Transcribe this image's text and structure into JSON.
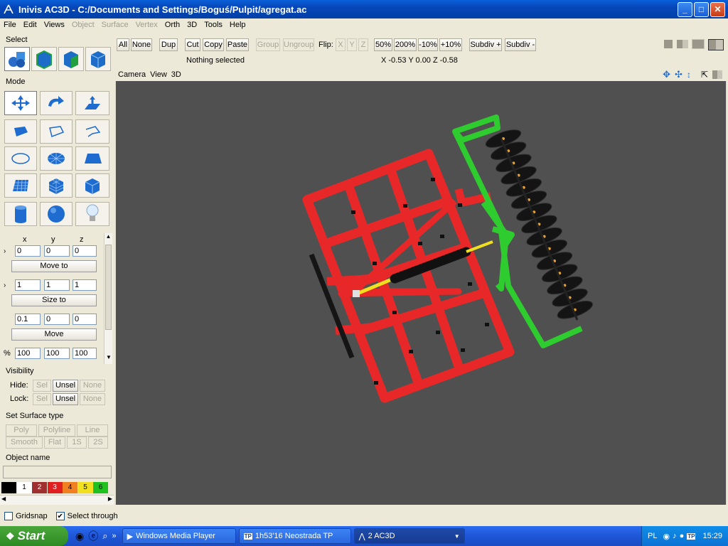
{
  "title": "Inivis AC3D - C:/Documents and Settings/Boguś/Pulpit/agregat.ac",
  "menu": [
    "File",
    "Edit",
    "Views",
    "Object",
    "Surface",
    "Vertex",
    "Orth",
    "3D",
    "Tools",
    "Help"
  ],
  "left": {
    "select_label": "Select",
    "mode_label": "Mode",
    "xyz": [
      "x",
      "y",
      "z"
    ],
    "pos": [
      "0",
      "0",
      "0"
    ],
    "move_to": "Move to",
    "size": [
      "1",
      "1",
      "1"
    ],
    "size_to": "Size to",
    "move_vals": [
      "0.1",
      "0",
      "0"
    ],
    "move": "Move",
    "pct_label": "%",
    "pct": [
      "100",
      "100",
      "100"
    ],
    "visibility_label": "Visibility",
    "hide_label": "Hide:",
    "lock_label": "Lock:",
    "sel": "Sel",
    "unsel": "Unsel",
    "none": "None",
    "surface_label": "Set Surface type",
    "poly": "Poly",
    "polyline": "Polyline",
    "line": "Line",
    "smooth": "Smooth",
    "flat": "Flat",
    "s1": "1S",
    "s2": "2S",
    "objname_label": "Object name",
    "colors": [
      {
        "n": "",
        "c": "#000000"
      },
      {
        "n": "1",
        "c": "#ffffff"
      },
      {
        "n": "2",
        "c": "#a03030"
      },
      {
        "n": "3",
        "c": "#e02020"
      },
      {
        "n": "4",
        "c": "#f08020"
      },
      {
        "n": "5",
        "c": "#f0e020"
      },
      {
        "n": "6",
        "c": "#20c020"
      }
    ]
  },
  "toolbar": {
    "all": "All",
    "none": "None",
    "dup": "Dup",
    "cut": "Cut",
    "copy": "Copy",
    "paste": "Paste",
    "group": "Group",
    "ungroup": "Ungroup",
    "flip": "Flip:",
    "fx": "X",
    "fy": "Y",
    "fz": "Z",
    "z50": "50%",
    "z200": "200%",
    "zm10": "-10%",
    "zp10": "+10%",
    "subdiv_plus": "Subdiv +",
    "subdiv_minus": "Subdiv -",
    "status": "Nothing selected",
    "coords": "X -0.53 Y 0.00 Z -0.58"
  },
  "viewport": {
    "menu": [
      "Camera",
      "View",
      "3D"
    ]
  },
  "statusbar": {
    "gridsnap": "Gridsnap",
    "select_through": "Select through"
  },
  "taskbar": {
    "start": "Start",
    "tasks": [
      "Windows Media Player",
      "1h53'16 Neostrada TP",
      "2 AC3D"
    ],
    "lang": "PL",
    "time": "15:29"
  }
}
